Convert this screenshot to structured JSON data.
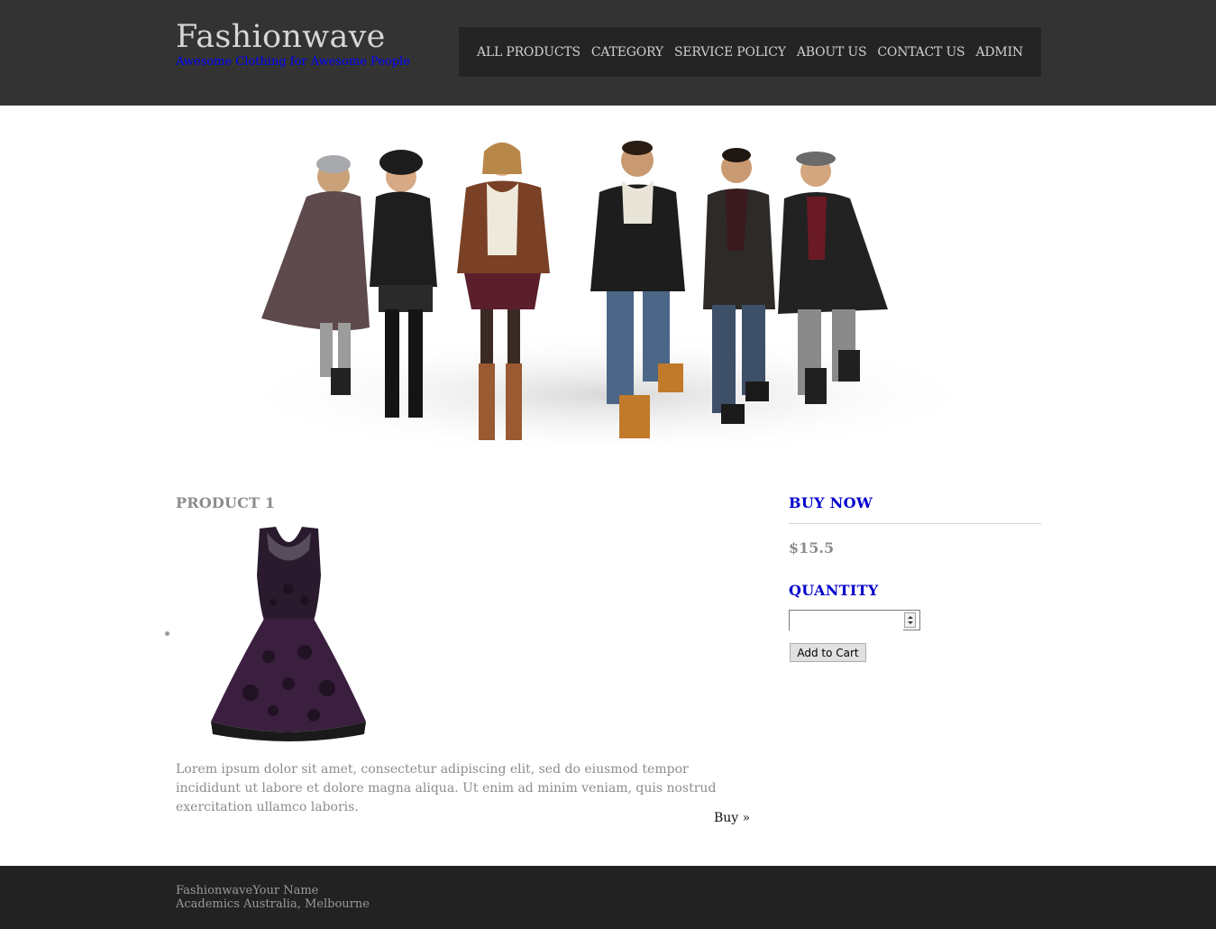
{
  "header": {
    "site_title": "Fashionwave",
    "tagline": "Awesome Clothing for Awesome People",
    "background_color": "#333333",
    "tagline_color": "#0000ff"
  },
  "nav": {
    "items": [
      {
        "label": "ALL PRODUCTS"
      },
      {
        "label": "CATEGORY"
      },
      {
        "label": "SERVICE POLICY"
      },
      {
        "label": "ABOUT US"
      },
      {
        "label": "CONTACT US"
      },
      {
        "label": "ADMIN"
      }
    ]
  },
  "banner": {
    "icon": "group-of-models-photo"
  },
  "product": {
    "title": "PRODUCT 1",
    "image_icon": "purple-lace-dress-photo",
    "description": "Lorem ipsum dolor sit amet, consectetur adipiscing elit, sed do eiusmod tempor incididunt ut labore et dolore magna aliqua. Ut enim ad minim veniam, quis nostrud exercitation ullamco laboris.",
    "buy_link": "Buy »"
  },
  "sidebar": {
    "buy_now_heading": "BUY NOW",
    "price": "$15.5",
    "quantity_heading": "QUANTITY",
    "quantity_value": "",
    "add_to_cart_label": "Add to Cart",
    "heading_color": "#0000cc"
  },
  "footer": {
    "line1": "FashionwaveYour Name",
    "line2": "Academics Australia, Melbourne"
  }
}
